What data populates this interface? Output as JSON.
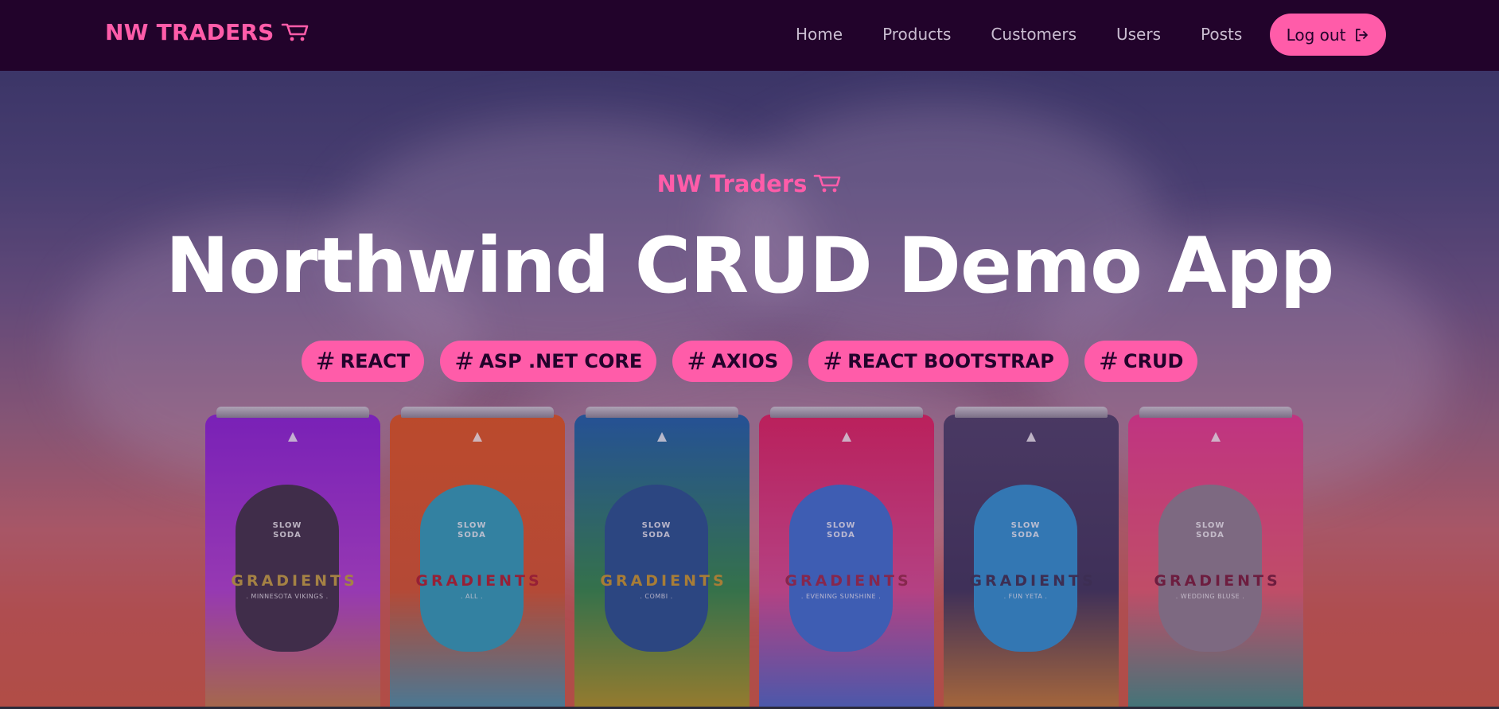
{
  "navbar": {
    "brand": "NW TRADERS",
    "links": [
      "Home",
      "Products",
      "Customers",
      "Users",
      "Posts"
    ],
    "logout_label": "Log out"
  },
  "hero": {
    "brand": "NW Traders",
    "title": "Northwind CRUD Demo App",
    "tags": [
      "REACT",
      "ASP .NET CORE",
      "AXIOS",
      "REACT BOOTSTRAP",
      "CRUD"
    ]
  },
  "cans": [
    {
      "slow": "SLOW",
      "soda": "SODA",
      "brand": "GRADIENTS",
      "flavor": ". MINNESOTA VIKINGS .",
      "colors": [
        "#8a1fd6",
        "#b13fd0",
        "#c98a2a"
      ],
      "label": "#3e2f45",
      "brand_color": "#c5a03c"
    },
    {
      "slow": "SLOW",
      "soda": "SODA",
      "brand": "GRADIENTS",
      "flavor": ". ALL .",
      "colors": [
        "#e2561d",
        "#d9552a",
        "#2ea0c0"
      ],
      "label": "#2d9fb8",
      "brand_color": "#b21e2a"
    },
    {
      "slow": "SLOW",
      "soda": "SODA",
      "brand": "GRADIENTS",
      "flavor": ". COMBI .",
      "colors": [
        "#1a5fa8",
        "#2f8a46",
        "#c99a18"
      ],
      "label": "#23508e",
      "brand_color": "#c89a2a"
    },
    {
      "slow": "SLOW",
      "soda": "SODA",
      "brand": "GRADIENTS",
      "flavor": ". EVENING SUNSHINE .",
      "colors": [
        "#e01e5c",
        "#d94a90",
        "#2f6fd0"
      ],
      "label": "#3b6fd0",
      "brand_color": "#9b2748"
    },
    {
      "slow": "SLOW",
      "soda": "SODA",
      "brand": "GRADIENTS",
      "flavor": ". FUN YETA .",
      "colors": [
        "#4b3f66",
        "#3c3358",
        "#e08a2a"
      ],
      "label": "#2c92d0",
      "brand_color": "#3a3150"
    },
    {
      "slow": "SLOW",
      "soda": "SODA",
      "brand": "GRADIENTS",
      "flavor": ". WEDDING BLUSE .",
      "colors": [
        "#e8388e",
        "#e85a6c",
        "#1f9a88"
      ],
      "label": "#8f7f8e",
      "brand_color": "#7a1a36"
    }
  ],
  "colors": {
    "accent": "#ff5ca9",
    "navbar_bg": "#22032b",
    "nav_text": "#c9bcd0",
    "title": "#ffffff"
  },
  "icons": {
    "brand": "shopping-cart-icon",
    "logout": "sign-out-icon",
    "tag": "hash-icon"
  }
}
